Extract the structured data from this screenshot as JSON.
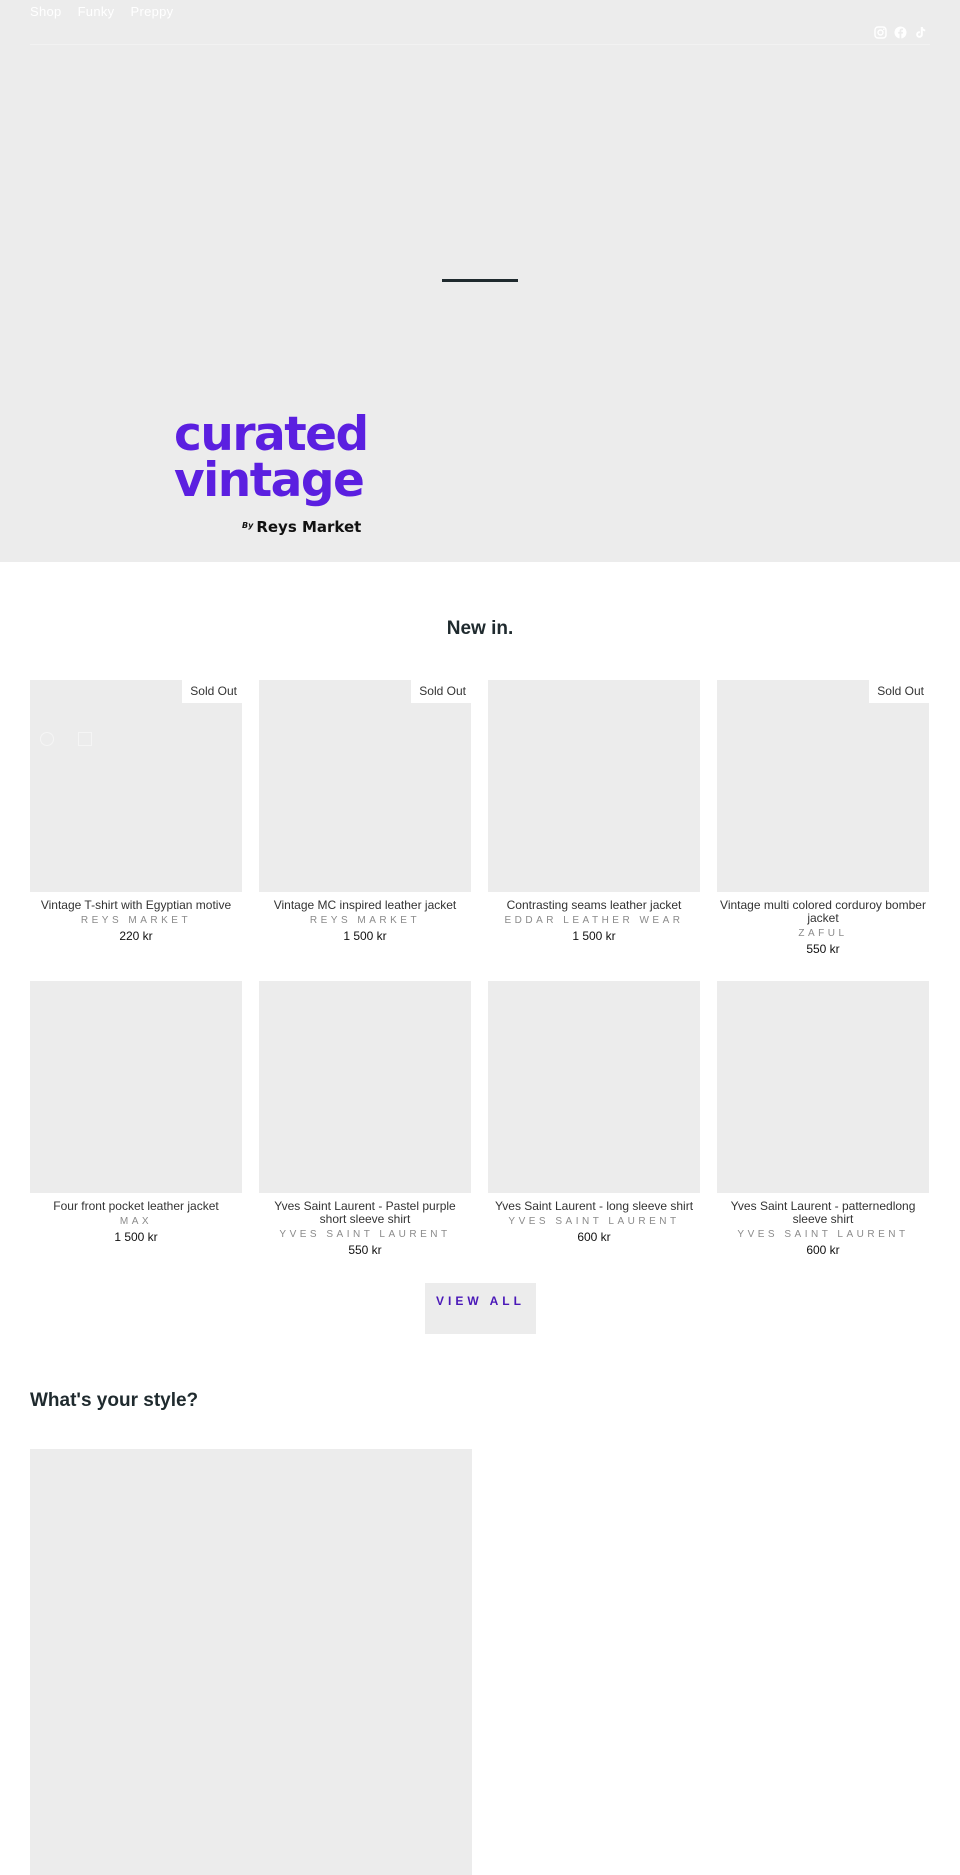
{
  "nav": {
    "items": [
      {
        "label": "Shop"
      },
      {
        "label": "Funky"
      },
      {
        "label": "Preppy"
      }
    ],
    "socials": [
      "instagram-icon",
      "facebook-icon",
      "tiktok-icon"
    ]
  },
  "hero": {
    "logo_line1": "curated",
    "logo_line2": "vintage",
    "logo_by": "By",
    "logo_brand": "Reys Market",
    "brand_color": "#5b1fe0"
  },
  "new_in": {
    "title": "New in.",
    "sold_out_label": "Sold Out",
    "products": [
      {
        "title": "Vintage T-shirt with Egyptian motive",
        "vendor": "Reys Market",
        "price": "220 kr",
        "sold_out": true
      },
      {
        "title": "Vintage MC inspired leather jacket",
        "vendor": "Reys Market",
        "price": "1 500 kr",
        "sold_out": true
      },
      {
        "title": "Contrasting seams leather jacket",
        "vendor": "Eddar Leather Wear",
        "price": "1 500 kr",
        "sold_out": false
      },
      {
        "title": "Vintage multi colored corduroy bomber jacket",
        "vendor": "Zaful",
        "price": "550 kr",
        "sold_out": true
      },
      {
        "title": "Four front pocket leather jacket",
        "vendor": "Max",
        "price": "1 500 kr",
        "sold_out": false
      },
      {
        "title": "Yves Saint Laurent - Pastel purple short sleeve shirt",
        "vendor": "Yves Saint Laurent",
        "price": "550 kr",
        "sold_out": false
      },
      {
        "title": "Yves Saint Laurent - long sleeve shirt",
        "vendor": "Yves Saint Laurent",
        "price": "600 kr",
        "sold_out": false
      },
      {
        "title": "Yves Saint Laurent - patternedlong sleeve shirt",
        "vendor": "Yves Saint Laurent",
        "price": "600 kr",
        "sold_out": false
      }
    ],
    "view_all_label": "VIEW ALL"
  },
  "style_section": {
    "title": "What's your style?"
  }
}
